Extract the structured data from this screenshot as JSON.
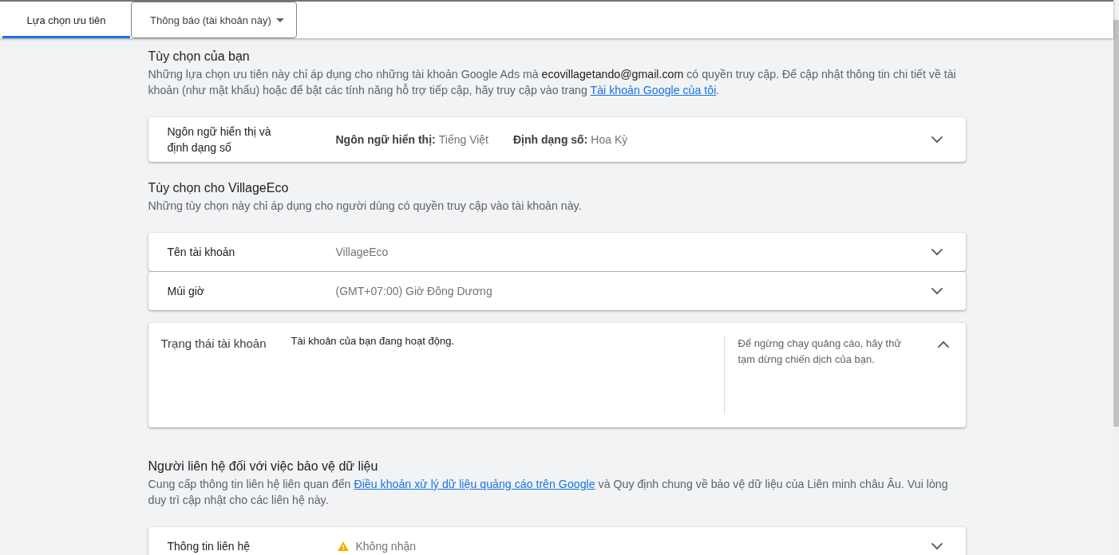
{
  "tabs": [
    {
      "label": "Lựa chọn ưu tiên",
      "kind": "tab",
      "selected": true
    },
    {
      "label": "Thông báo (tài khoản này)",
      "kind": "dropdown",
      "selected": false
    }
  ],
  "sections": [
    {
      "title": "Tùy chọn của bạn",
      "description": [
        {
          "kind": "text",
          "text": "Những lựa chọn ưu tiên này chỉ áp dụng cho những tài khoản Google Ads mà "
        },
        {
          "kind": "emphasis",
          "text": "ecovillagetando@gmail.com"
        },
        {
          "kind": "text",
          "text": " có quyền truy cập. Để cập nhật thông tin chi tiết về tài khoản (như mật khẩu) hoặc để bật các tính năng hỗ trợ tiếp cập, hãy truy cập vào trang "
        },
        {
          "kind": "link",
          "text": "Tài khoản Google của tôi"
        },
        {
          "kind": "text",
          "text": "."
        }
      ],
      "cards": [
        {
          "label": "Ngôn ngữ hiển thị và định dạng số",
          "expanded": false,
          "fields": [
            {
              "label": "Ngôn ngữ hiển thị:",
              "value": "Tiếng Việt",
              "warning": false
            },
            {
              "label": "Định dạng số:",
              "value": "Hoa Kỳ",
              "warning": false
            }
          ]
        }
      ]
    },
    {
      "title": "Tùy chọn cho VillageEco",
      "description": [
        {
          "kind": "text",
          "text": "Những tùy chọn này chỉ áp dụng cho người dùng có quyền truy cập vào tài khoản này."
        }
      ],
      "cards": [
        {
          "label": "Tên tài khoản",
          "expanded": false,
          "fields": [
            {
              "value": "VillageEco",
              "warning": false
            }
          ]
        },
        {
          "label": "Múi giờ",
          "expanded": false,
          "fields": [
            {
              "value": "(GMT+07:00) Giờ Đông Dương",
              "warning": false
            }
          ]
        },
        {
          "label": "Trạng thái tài khoản",
          "expanded": true,
          "body": "Tài khoản của bạn đang hoạt động.",
          "note": "Để ngừng chạy quảng cáo, hãy thử tạm dừng chiến dịch của bạn."
        }
      ]
    },
    {
      "title": "Người liên hệ đối với việc bảo vệ dữ liệu",
      "description": [
        {
          "kind": "text",
          "text": "Cung cấp thông tin liên hệ liên quan đến "
        },
        {
          "kind": "link",
          "text": "Điều khoản xử lý dữ liệu quảng cáo trên Google"
        },
        {
          "kind": "text",
          "text": " và Quy định chung về bảo vệ dữ liệu của Liên minh châu Âu. Vui lòng duy trì cập nhật cho các liên hệ này."
        }
      ],
      "cards": [
        {
          "label": "Thông tin liên hệ",
          "expanded": false,
          "fields": [
            {
              "value": "Không nhận",
              "warning": true
            }
          ]
        }
      ]
    }
  ]
}
